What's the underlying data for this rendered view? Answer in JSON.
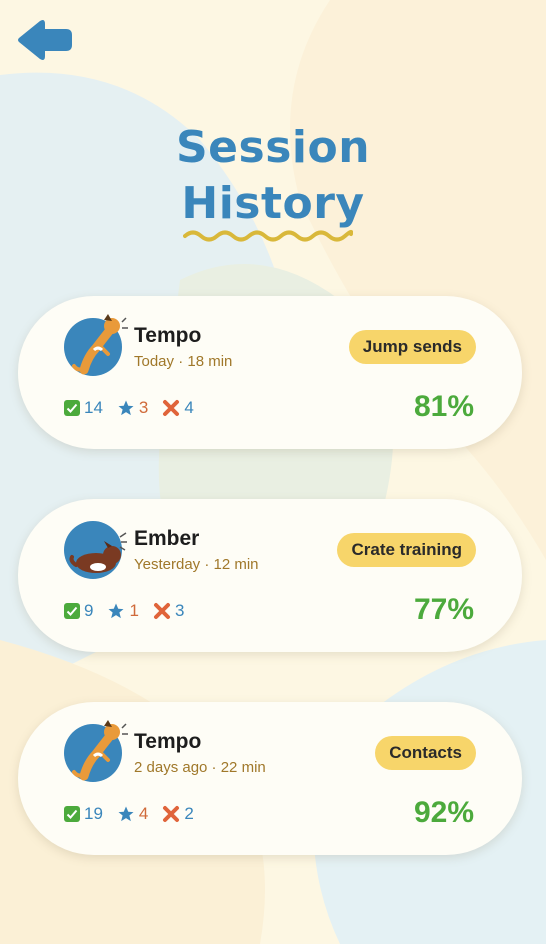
{
  "header": {
    "back_icon": "back-arrow-icon",
    "title_line1": "Session",
    "title_line2": "History"
  },
  "colors": {
    "accent_blue": "#3a86bb",
    "tag_yellow": "#f7d56a",
    "percent_green": "#4caa3c",
    "star_orange": "#d06a3a",
    "background": "#fdf7e3"
  },
  "sessions": [
    {
      "dog_name": "Tempo",
      "avatar_icon": "jumping-dog-icon",
      "meta": "Today · 18 min",
      "tag": "Jump sends",
      "successes": "14",
      "stars": "3",
      "misses": "4",
      "percent": "81%"
    },
    {
      "dog_name": "Ember",
      "avatar_icon": "lying-dog-icon",
      "meta": "Yesterday · 12 min",
      "tag": "Crate training",
      "successes": "9",
      "stars": "1",
      "misses": "3",
      "percent": "77%"
    },
    {
      "dog_name": "Tempo",
      "avatar_icon": "jumping-dog-icon",
      "meta": "2 days ago · 22 min",
      "tag": "Contacts",
      "successes": "19",
      "stars": "4",
      "misses": "2",
      "percent": "92%"
    }
  ]
}
